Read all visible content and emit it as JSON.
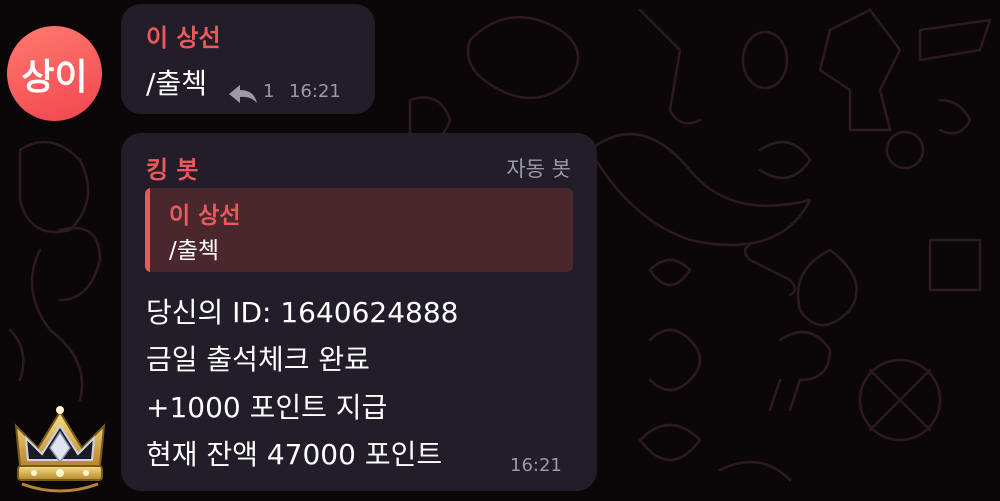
{
  "chat": {
    "messages": [
      {
        "avatar_text": "상이",
        "sender": "이 상선",
        "text": "/출첵",
        "reply_count": "1",
        "time": "16:21"
      },
      {
        "sender": "킹 봇",
        "tag": "자동 봇",
        "quote": {
          "sender": "이 상선",
          "text": "/출첵"
        },
        "lines": [
          "당신의 ID: 1640624888",
          "금일 출석체크 완료",
          "+1000 포인트 지급",
          "현재 잔액 47000 포인트"
        ],
        "time": "16:21"
      }
    ]
  },
  "colors": {
    "background": "#0b0608",
    "bubble": "#221d28",
    "accent": "#ea5a5c",
    "quote_bg": "#4a272c",
    "meta": "#9a9aa4"
  },
  "icons": [
    "reply-arrow-icon",
    "crown-avatar-icon"
  ]
}
